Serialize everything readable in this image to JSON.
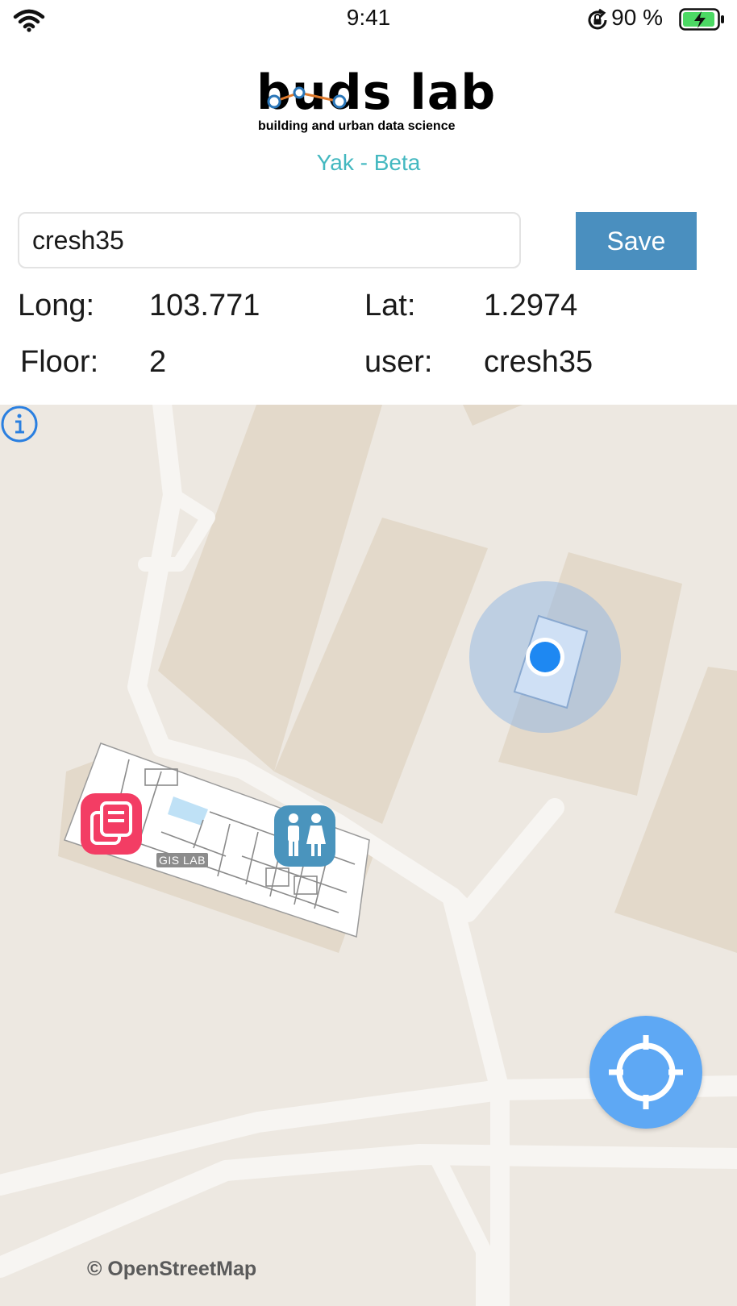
{
  "status_bar": {
    "time": "9:41",
    "battery_percent": "90 %",
    "icons": [
      "wifi-icon",
      "orientation-lock-icon",
      "battery-charging-icon"
    ]
  },
  "header": {
    "logo_text": "buds lab",
    "logo_tagline": "building and urban data science",
    "subtitle": "Yak - Beta"
  },
  "form": {
    "user_value": "cresh35",
    "save_label": "Save"
  },
  "info": {
    "long_label": "Long:",
    "long_value": "103.771",
    "lat_label": "Lat:",
    "lat_value": "1.2974",
    "floor_label": "Floor:",
    "floor_value": "2",
    "user_label": "user:",
    "user_value": "cresh35"
  },
  "map": {
    "room_label": "GIS LAB",
    "attribution": "© OpenStreetMap",
    "icons": [
      "library-icon",
      "restroom-icon",
      "current-location-dot",
      "locate-me-icon",
      "info-icon"
    ]
  },
  "colors": {
    "accent": "#43b8c0",
    "save_button": "#4a8fbf",
    "locate_button": "#5ea8f4",
    "location_dot": "#1e88f2",
    "map_background": "#ede8e1",
    "building": "#e3d9ca",
    "library_icon_bg": "#f33d64",
    "restroom_icon_bg": "#4a94bd"
  }
}
